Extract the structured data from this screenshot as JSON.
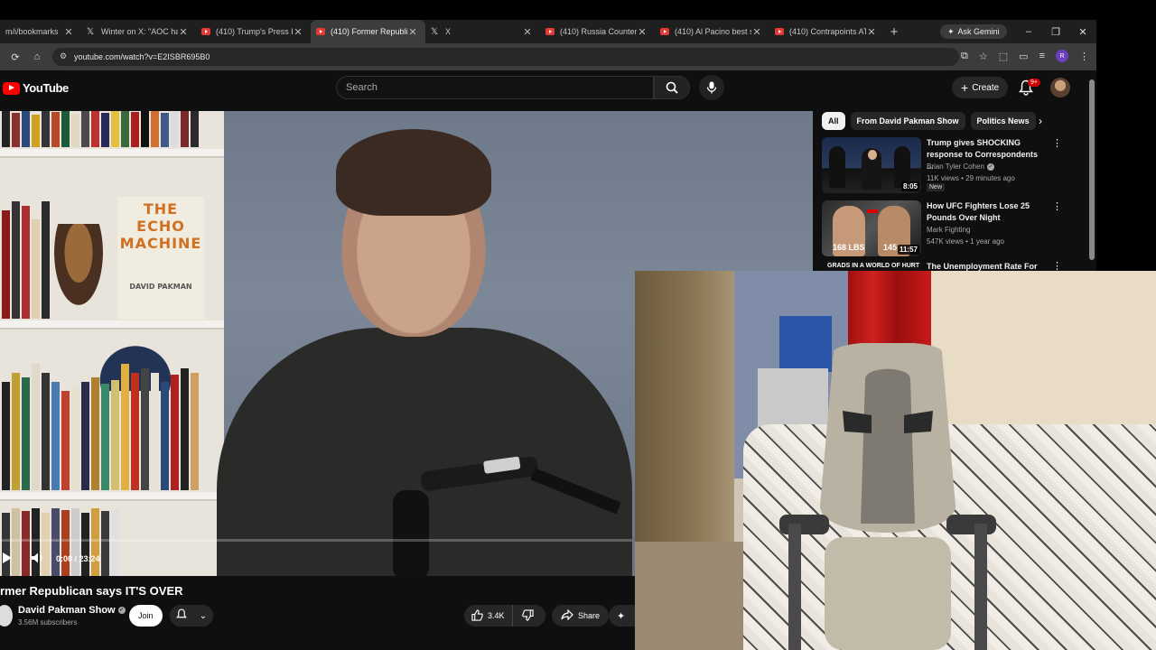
{
  "browser": {
    "tabs": [
      {
        "label": "m/i/bookmarks",
        "favicon": "none",
        "active": false
      },
      {
        "label": "Winter on X: \"AOC has",
        "favicon": "x-icon",
        "active": false
      },
      {
        "label": "(410) Trump's Press Din",
        "favicon": "youtube-icon",
        "active": false
      },
      {
        "label": "(410) Former Republica",
        "favicon": "youtube-icon",
        "active": true
      },
      {
        "label": "X",
        "favicon": "x-icon",
        "active": false
      },
      {
        "label": "(410) Russia Counterat",
        "favicon": "youtube-icon",
        "active": false
      },
      {
        "label": "(410) Al Pacino best sp",
        "favicon": "youtube-icon",
        "active": false
      },
      {
        "label": "(410) Contrapoints ATT",
        "favicon": "youtube-icon",
        "active": false
      }
    ],
    "new_tab": "+",
    "ask_gemini": "Ask Gemini",
    "url": "youtube.com/watch?v=E2ISBR695B0",
    "profile_initial": "R"
  },
  "youtube": {
    "logo_text": "YouTube",
    "search_placeholder": "Search",
    "create_label": "Create",
    "notification_badge": "9+",
    "video": {
      "time_display": "0:00 / 23:24",
      "title": "rmer Republican says IT'S OVER",
      "channel_name": "David Pakman Show",
      "subscribers": "3.56M subscribers",
      "join_label": "Join",
      "like_count": "3.4K",
      "share_label": "Share",
      "book_title": "THE ECHO MACHINE",
      "book_author": "DAVID PAKMAN"
    },
    "chips": [
      "All",
      "From David Pakman Show",
      "Politics News"
    ],
    "recommendations": [
      {
        "title": "Trump gives SHOCKING response to Correspondents ...",
        "channel": "Brian Tyler Cohen",
        "verified": true,
        "meta": "11K views • 29 minutes ago",
        "badge": "New",
        "duration": "8:05"
      },
      {
        "title": "How UFC Fighters Lose 25 Pounds Over Night",
        "channel": "Mark Fighting",
        "verified": false,
        "meta": "547K views • 1 year ago",
        "duration": "11:57",
        "thumb_text": "168 LBS",
        "thumb_text2": "145"
      },
      {
        "title": "The Unemployment Rate For",
        "thumb_text": "GRADS IN A WORLD OF HURT"
      }
    ]
  },
  "colors": {
    "accent": "#ff0000",
    "background": "#0f0f0f",
    "chip_active": "#f1f1f1"
  }
}
